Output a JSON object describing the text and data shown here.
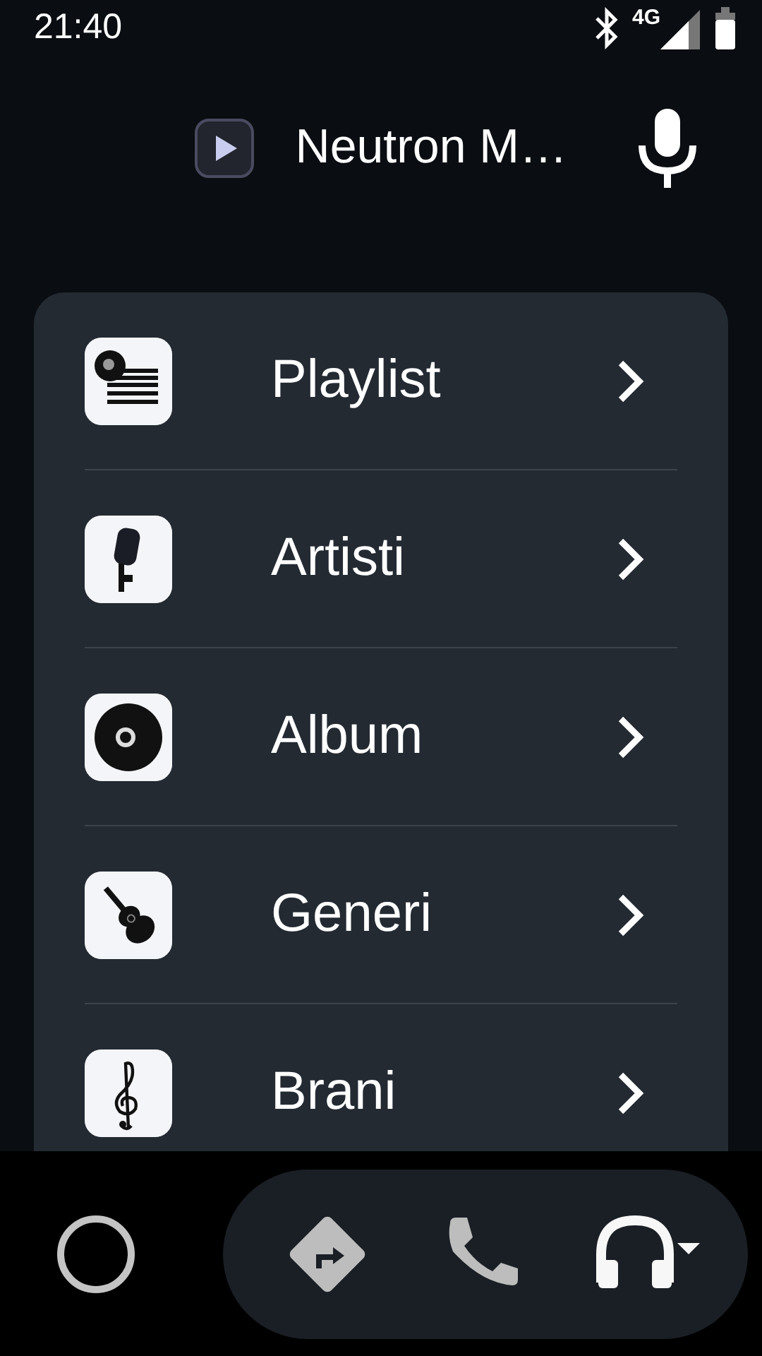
{
  "status_bar": {
    "time": "21:40",
    "network": "4G"
  },
  "header": {
    "title": "Neutron M…"
  },
  "menu": [
    {
      "label": "Playlist",
      "kind": "playlist"
    },
    {
      "label": "Artisti",
      "kind": "microphone"
    },
    {
      "label": "Album",
      "kind": "disc"
    },
    {
      "label": "Generi",
      "kind": "guitar"
    },
    {
      "label": "Brani",
      "kind": "clef"
    }
  ],
  "nav": [
    {
      "kind": "navigation",
      "selected": false
    },
    {
      "kind": "phone",
      "selected": false
    },
    {
      "kind": "audio",
      "selected": true
    }
  ]
}
